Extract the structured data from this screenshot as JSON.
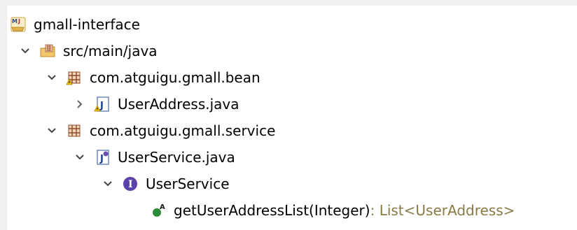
{
  "tree": {
    "project": {
      "label": "gmall-interface",
      "icon": "maven-java-project-icon"
    },
    "source_folder": {
      "label": "src/main/java",
      "icon": "source-folder-icon"
    },
    "package_bean": {
      "label": "com.atguigu.gmall.bean",
      "icon": "package-icon"
    },
    "file_user_address": {
      "label": "UserAddress.java",
      "icon": "java-file-icon"
    },
    "package_service": {
      "label": "com.atguigu.gmall.service",
      "icon": "package-icon"
    },
    "file_user_service": {
      "label": "UserService.java",
      "icon": "java-interface-file-icon"
    },
    "interface_user_service": {
      "label": "UserService",
      "icon": "interface-icon"
    },
    "method_get_user_address_list": {
      "label": "getUserAddressList(Integer)",
      "type_suffix": " : List<UserAddress>",
      "icon": "abstract-public-method-icon"
    }
  },
  "colors": {
    "panel_bg": "#ffffff",
    "frame_bg": "#f0f0f0",
    "type_text": "#8a7a44",
    "interface_icon": "#5b42a8",
    "method_icon": "#2e8a3a",
    "warning": "#e0a800"
  }
}
